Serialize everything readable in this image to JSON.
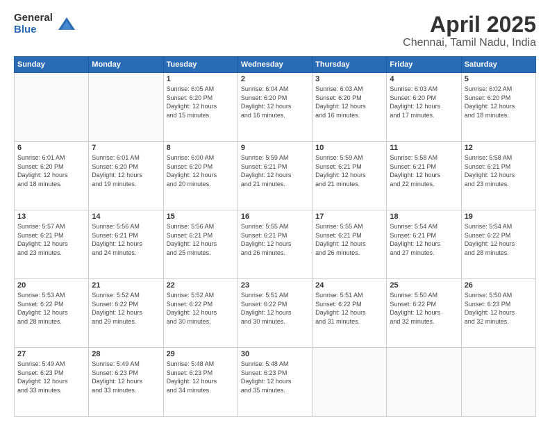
{
  "logo": {
    "general": "General",
    "blue": "Blue"
  },
  "title": "April 2025",
  "subtitle": "Chennai, Tamil Nadu, India",
  "weekdays": [
    "Sunday",
    "Monday",
    "Tuesday",
    "Wednesday",
    "Thursday",
    "Friday",
    "Saturday"
  ],
  "weeks": [
    [
      {
        "day": "",
        "info": ""
      },
      {
        "day": "",
        "info": ""
      },
      {
        "day": "1",
        "info": "Sunrise: 6:05 AM\nSunset: 6:20 PM\nDaylight: 12 hours\nand 15 minutes."
      },
      {
        "day": "2",
        "info": "Sunrise: 6:04 AM\nSunset: 6:20 PM\nDaylight: 12 hours\nand 16 minutes."
      },
      {
        "day": "3",
        "info": "Sunrise: 6:03 AM\nSunset: 6:20 PM\nDaylight: 12 hours\nand 16 minutes."
      },
      {
        "day": "4",
        "info": "Sunrise: 6:03 AM\nSunset: 6:20 PM\nDaylight: 12 hours\nand 17 minutes."
      },
      {
        "day": "5",
        "info": "Sunrise: 6:02 AM\nSunset: 6:20 PM\nDaylight: 12 hours\nand 18 minutes."
      }
    ],
    [
      {
        "day": "6",
        "info": "Sunrise: 6:01 AM\nSunset: 6:20 PM\nDaylight: 12 hours\nand 18 minutes."
      },
      {
        "day": "7",
        "info": "Sunrise: 6:01 AM\nSunset: 6:20 PM\nDaylight: 12 hours\nand 19 minutes."
      },
      {
        "day": "8",
        "info": "Sunrise: 6:00 AM\nSunset: 6:20 PM\nDaylight: 12 hours\nand 20 minutes."
      },
      {
        "day": "9",
        "info": "Sunrise: 5:59 AM\nSunset: 6:21 PM\nDaylight: 12 hours\nand 21 minutes."
      },
      {
        "day": "10",
        "info": "Sunrise: 5:59 AM\nSunset: 6:21 PM\nDaylight: 12 hours\nand 21 minutes."
      },
      {
        "day": "11",
        "info": "Sunrise: 5:58 AM\nSunset: 6:21 PM\nDaylight: 12 hours\nand 22 minutes."
      },
      {
        "day": "12",
        "info": "Sunrise: 5:58 AM\nSunset: 6:21 PM\nDaylight: 12 hours\nand 23 minutes."
      }
    ],
    [
      {
        "day": "13",
        "info": "Sunrise: 5:57 AM\nSunset: 6:21 PM\nDaylight: 12 hours\nand 23 minutes."
      },
      {
        "day": "14",
        "info": "Sunrise: 5:56 AM\nSunset: 6:21 PM\nDaylight: 12 hours\nand 24 minutes."
      },
      {
        "day": "15",
        "info": "Sunrise: 5:56 AM\nSunset: 6:21 PM\nDaylight: 12 hours\nand 25 minutes."
      },
      {
        "day": "16",
        "info": "Sunrise: 5:55 AM\nSunset: 6:21 PM\nDaylight: 12 hours\nand 26 minutes."
      },
      {
        "day": "17",
        "info": "Sunrise: 5:55 AM\nSunset: 6:21 PM\nDaylight: 12 hours\nand 26 minutes."
      },
      {
        "day": "18",
        "info": "Sunrise: 5:54 AM\nSunset: 6:21 PM\nDaylight: 12 hours\nand 27 minutes."
      },
      {
        "day": "19",
        "info": "Sunrise: 5:54 AM\nSunset: 6:22 PM\nDaylight: 12 hours\nand 28 minutes."
      }
    ],
    [
      {
        "day": "20",
        "info": "Sunrise: 5:53 AM\nSunset: 6:22 PM\nDaylight: 12 hours\nand 28 minutes."
      },
      {
        "day": "21",
        "info": "Sunrise: 5:52 AM\nSunset: 6:22 PM\nDaylight: 12 hours\nand 29 minutes."
      },
      {
        "day": "22",
        "info": "Sunrise: 5:52 AM\nSunset: 6:22 PM\nDaylight: 12 hours\nand 30 minutes."
      },
      {
        "day": "23",
        "info": "Sunrise: 5:51 AM\nSunset: 6:22 PM\nDaylight: 12 hours\nand 30 minutes."
      },
      {
        "day": "24",
        "info": "Sunrise: 5:51 AM\nSunset: 6:22 PM\nDaylight: 12 hours\nand 31 minutes."
      },
      {
        "day": "25",
        "info": "Sunrise: 5:50 AM\nSunset: 6:22 PM\nDaylight: 12 hours\nand 32 minutes."
      },
      {
        "day": "26",
        "info": "Sunrise: 5:50 AM\nSunset: 6:23 PM\nDaylight: 12 hours\nand 32 minutes."
      }
    ],
    [
      {
        "day": "27",
        "info": "Sunrise: 5:49 AM\nSunset: 6:23 PM\nDaylight: 12 hours\nand 33 minutes."
      },
      {
        "day": "28",
        "info": "Sunrise: 5:49 AM\nSunset: 6:23 PM\nDaylight: 12 hours\nand 33 minutes."
      },
      {
        "day": "29",
        "info": "Sunrise: 5:48 AM\nSunset: 6:23 PM\nDaylight: 12 hours\nand 34 minutes."
      },
      {
        "day": "30",
        "info": "Sunrise: 5:48 AM\nSunset: 6:23 PM\nDaylight: 12 hours\nand 35 minutes."
      },
      {
        "day": "",
        "info": ""
      },
      {
        "day": "",
        "info": ""
      },
      {
        "day": "",
        "info": ""
      }
    ]
  ]
}
